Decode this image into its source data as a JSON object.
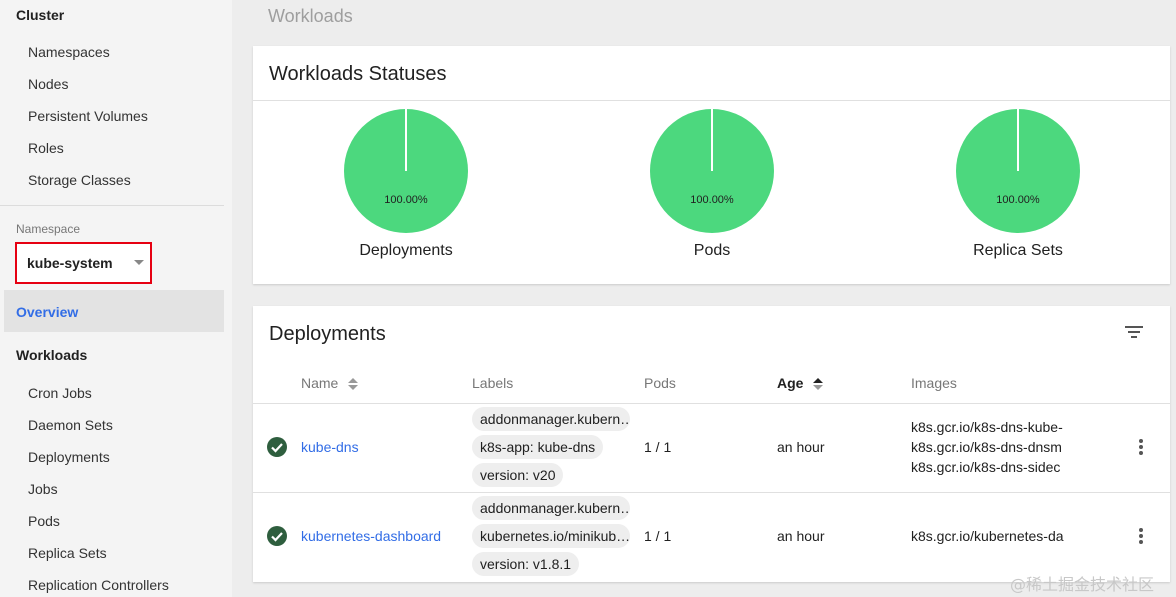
{
  "sidebar": {
    "cluster_title": "Cluster",
    "cluster_items": [
      "Namespaces",
      "Nodes",
      "Persistent Volumes",
      "Roles",
      "Storage Classes"
    ],
    "namespace_label": "Namespace",
    "namespace_value": "kube-system",
    "overview": "Overview",
    "workloads_title": "Workloads",
    "workload_items": [
      "Cron Jobs",
      "Daemon Sets",
      "Deployments",
      "Jobs",
      "Pods",
      "Replica Sets",
      "Replication Controllers"
    ]
  },
  "page_title": "Workloads",
  "statuses_card": {
    "title": "Workloads Statuses",
    "charts": [
      {
        "label": "Deployments",
        "percent": "100.00%",
        "value": 100
      },
      {
        "label": "Pods",
        "percent": "100.00%",
        "value": 100
      },
      {
        "label": "Replica Sets",
        "percent": "100.00%",
        "value": 100
      }
    ],
    "pie_color": "#4cd87e"
  },
  "deployments_card": {
    "title": "Deployments",
    "columns": {
      "name": "Name",
      "labels": "Labels",
      "pods": "Pods",
      "age": "Age",
      "images": "Images"
    },
    "rows": [
      {
        "name": "kube-dns",
        "labels": [
          "addonmanager.kubern…",
          "k8s-app: kube-dns",
          "version: v20"
        ],
        "pods": "1 / 1",
        "age": "an hour",
        "images": [
          "k8s.gcr.io/k8s-dns-kube-",
          "k8s.gcr.io/k8s-dns-dnsm",
          "k8s.gcr.io/k8s-dns-sidec"
        ]
      },
      {
        "name": "kubernetes-dashboard",
        "labels": [
          "addonmanager.kubern…",
          "kubernetes.io/minikub…",
          "version: v1.8.1"
        ],
        "pods": "1 / 1",
        "age": "an hour",
        "images": [
          "k8s.gcr.io/kubernetes-da"
        ]
      }
    ]
  },
  "watermark": "@稀土掘金技术社区",
  "colors": {
    "accent": "#326de6",
    "highlight_border": "#e60012",
    "status_ok": "#2e5e3e"
  }
}
